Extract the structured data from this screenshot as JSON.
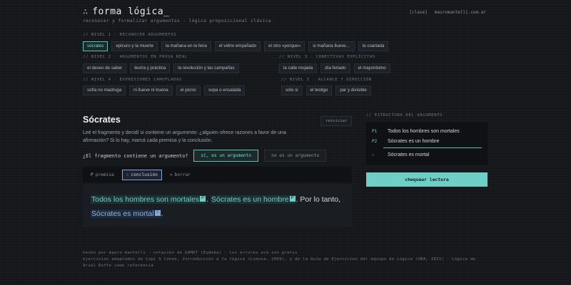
{
  "header": {
    "brand_mark": "∴",
    "brand_title": "forma lógica_",
    "tagline": "reconocer y formalizar argumentos · lógica proposicional clásica",
    "nav_clase": "[clase]",
    "nav_site": "mauromantelli.com.ar"
  },
  "levels": {
    "n1": {
      "label": "// NIVEL 1 · RECONOCER ARGUMENTOS",
      "items": [
        "sócrates",
        "epicuro y la muerte",
        "la mañana en la feria",
        "el vidrio empañado",
        "el otro «porque»",
        "si mañana llueve…",
        "la coartada"
      ]
    },
    "n2": {
      "label": "// NIVEL 2 · ARGUMENTOS EN PROSA REAL",
      "items": [
        "el deseo de saber",
        "teoría y práctica",
        "la revolución y las campañas"
      ]
    },
    "n3": {
      "label": "// NIVEL 3 · CONECTIVAS EXPLÍCITAS",
      "items": [
        "la calle mojada",
        "día feriado",
        "el mayordomo"
      ]
    },
    "n4": {
      "label": "// NIVEL 4 · EXPRESIONES CAMUFLADAS",
      "items": [
        "sofía no madruga",
        "ni llueve ni truena",
        "el picnic",
        "sopa o ensalada"
      ]
    },
    "n5": {
      "label": "// NIVEL 5 · ALCANCE Y DIRECCIÓN",
      "items": [
        "sólo si",
        "el testigo",
        "par y divisible"
      ]
    }
  },
  "lesson": {
    "title": "Sócrates",
    "restart": "reiniciar",
    "description": "Leé el fragmento y decidí si contiene un argumento: ¿alguien ofrece razones a favor de una afirmación? Si lo hay, marcá cada premisa y la conclusión.",
    "question": "¿El fragmento contiene un argumento?",
    "opt_yes": "sí, es un argumento",
    "opt_no": "no es un argumento",
    "tool_premise_icon": "P",
    "tool_premise": "premisa",
    "tool_conclusion_icon": "∴",
    "tool_conclusion": "conclusión",
    "tool_erase_icon": "×",
    "tool_erase": "borrar",
    "text": {
      "premise1": "Todos los hombres son mortales",
      "premise1_tag": "P",
      "sep1": ". ",
      "premise2": "Sócrates es un hombre",
      "premise2_tag": "P",
      "sep2": ". Por lo tanto, ",
      "conclusion": "Sócrates es mortal",
      "conclusion_tag": "∴",
      "end": "."
    }
  },
  "structure": {
    "label": "// ESTRUCTURA DEL ARGUMENTO",
    "p1_key": "P1",
    "p1": "Todos los hombres son mortales",
    "p2_key": "P2",
    "p2": "Sócrates es un hombre",
    "c_key": "∴",
    "c": "Sócrates es mortal",
    "check": "chequear lectura"
  },
  "footer": {
    "line1": "hecho por mauro mantelli · notación de GAMUT (Eudeba) · los errores acá son gratis",
    "line2_a": "ejercicios adaptados de Copi & Cohen, ",
    "line2_b": "Introducción a la lógica",
    "line2_c": " (Limusa, 2009), y de la ",
    "line2_d": "Guía de Ejercicios",
    "line2_e": " del equipo de Lógica (UBA, 2021) · Lógica de Ariel Roffe como referencia"
  },
  "colors": {
    "accent": "#6fcfc6",
    "conclusion": "#7fa8d9",
    "background": "#15171b"
  }
}
